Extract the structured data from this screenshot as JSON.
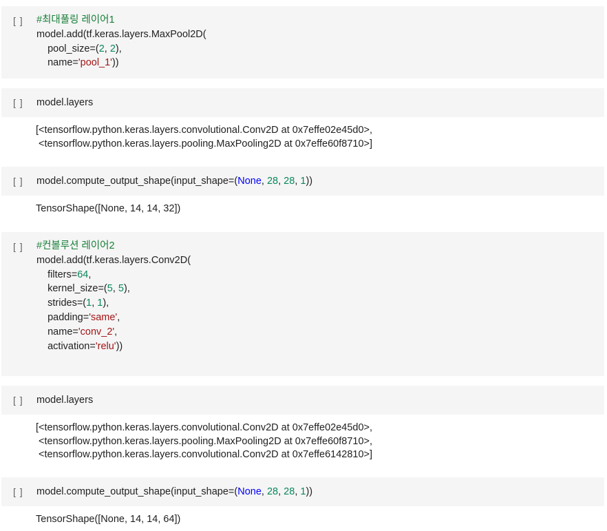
{
  "colors": {
    "cell_background": "#f5f5f5",
    "comment": "#188038",
    "number": "#09885a",
    "string": "#a31515",
    "keyword": "#0000ff"
  },
  "cells": [
    {
      "run_label": "[ ]",
      "code": {
        "comment": "#최대풀링 레이어1",
        "l2": "model.add(tf.keras.layers.MaxPool2D(",
        "l3a": "    pool_size=(",
        "l3n1": "2",
        "l3c": ", ",
        "l3n2": "2",
        "l3e": "),",
        "l4a": "    name=",
        "l4s": "'pool_1'",
        "l4e": "))"
      }
    },
    {
      "run_label": "[ ]",
      "code": "model.layers",
      "output": [
        "[<tensorflow.python.keras.layers.convolutional.Conv2D at 0x7effe02e45d0>,",
        " <tensorflow.python.keras.layers.pooling.MaxPooling2D at 0x7effe60f8710>]"
      ]
    },
    {
      "run_label": "[ ]",
      "code": {
        "a": "model.compute_output_shape(input_shape=(",
        "none": "None",
        "c1": ", ",
        "n1": "28",
        "c2": ", ",
        "n2": "28",
        "c3": ", ",
        "n3": "1",
        "e": "))"
      },
      "output": "TensorShape([None, 14, 14, 32])"
    },
    {
      "run_label": "[ ]",
      "code": {
        "comment": "#컨볼루션 레이어2",
        "l2": "model.add(tf.keras.layers.Conv2D(",
        "l3a": "    filters=",
        "l3n": "64",
        "l3e": ",",
        "l4a": "    kernel_size=(",
        "l4n1": "5",
        "l4c": ", ",
        "l4n2": "5",
        "l4e": "),",
        "l5a": "    strides=(",
        "l5n1": "1",
        "l5c": ", ",
        "l5n2": "1",
        "l5e": "),",
        "l6a": "    padding=",
        "l6s": "'same'",
        "l6e": ",",
        "l7a": "    name=",
        "l7s": "'conv_2'",
        "l7e": ",",
        "l8a": "    activation=",
        "l8s": "'relu'",
        "l8e": "))"
      }
    },
    {
      "run_label": "[ ]",
      "code": "model.layers",
      "output": [
        "[<tensorflow.python.keras.layers.convolutional.Conv2D at 0x7effe02e45d0>,",
        " <tensorflow.python.keras.layers.pooling.MaxPooling2D at 0x7effe60f8710>,",
        " <tensorflow.python.keras.layers.convolutional.Conv2D at 0x7effe6142810>]"
      ]
    },
    {
      "run_label": "[ ]",
      "code": {
        "a": "model.compute_output_shape(input_shape=(",
        "none": "None",
        "c1": ", ",
        "n1": "28",
        "c2": ", ",
        "n2": "28",
        "c3": ", ",
        "n3": "1",
        "e": "))"
      },
      "output": "TensorShape([None, 14, 14, 64])"
    }
  ]
}
